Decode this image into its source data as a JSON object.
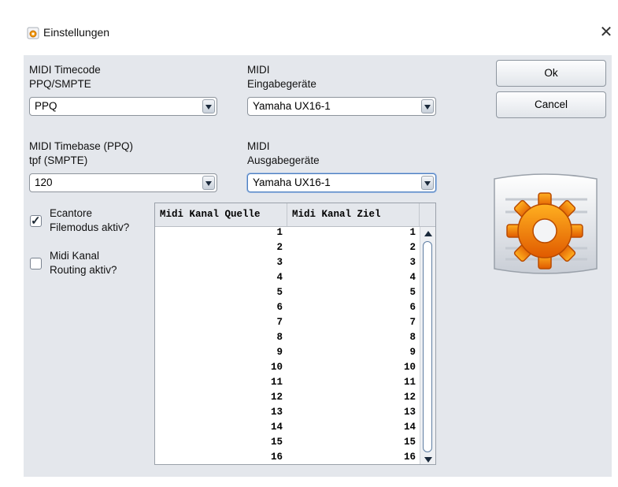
{
  "window": {
    "title": "Einstellungen",
    "close_glyph": "✕",
    "icon": "settings-app-icon"
  },
  "timecode": {
    "label_line1": "MIDI Timecode",
    "label_line2": "PPQ/SMPTE",
    "selected": "PPQ"
  },
  "input_devices": {
    "label_line1": "MIDI",
    "label_line2": "Eingabegeräte",
    "selected": "Yamaha UX16-1"
  },
  "timebase": {
    "label_line1": "MIDI Timebase (PPQ)",
    "label_line2": "tpf (SMPTE)",
    "selected": "120"
  },
  "output_devices": {
    "label_line1": "MIDI",
    "label_line2": "Ausgabegeräte",
    "selected": "Yamaha UX16-1"
  },
  "buttons": {
    "ok": "Ok",
    "cancel": "Cancel"
  },
  "options": {
    "filemode": {
      "line1": "Ecantore",
      "line2": "Filemodus aktiv?",
      "checked": true
    },
    "routing": {
      "line1": "Midi Kanal",
      "line2": "Routing aktiv?",
      "checked": false
    },
    "check_glyph": "✓"
  },
  "routing_table": {
    "headers": [
      "Midi Kanal Quelle",
      "Midi Kanal Ziel"
    ],
    "rows": [
      [
        "1",
        "1"
      ],
      [
        "2",
        "2"
      ],
      [
        "3",
        "3"
      ],
      [
        "4",
        "4"
      ],
      [
        "5",
        "5"
      ],
      [
        "6",
        "6"
      ],
      [
        "7",
        "7"
      ],
      [
        "8",
        "8"
      ],
      [
        "9",
        "9"
      ],
      [
        "10",
        "10"
      ],
      [
        "11",
        "11"
      ],
      [
        "12",
        "12"
      ],
      [
        "13",
        "13"
      ],
      [
        "14",
        "14"
      ],
      [
        "15",
        "15"
      ],
      [
        "16",
        "16"
      ]
    ]
  },
  "colors": {
    "client_bg": "#e4e7ec",
    "focus_border": "#4d7fc0",
    "gear_orange": "#f29a0f"
  }
}
